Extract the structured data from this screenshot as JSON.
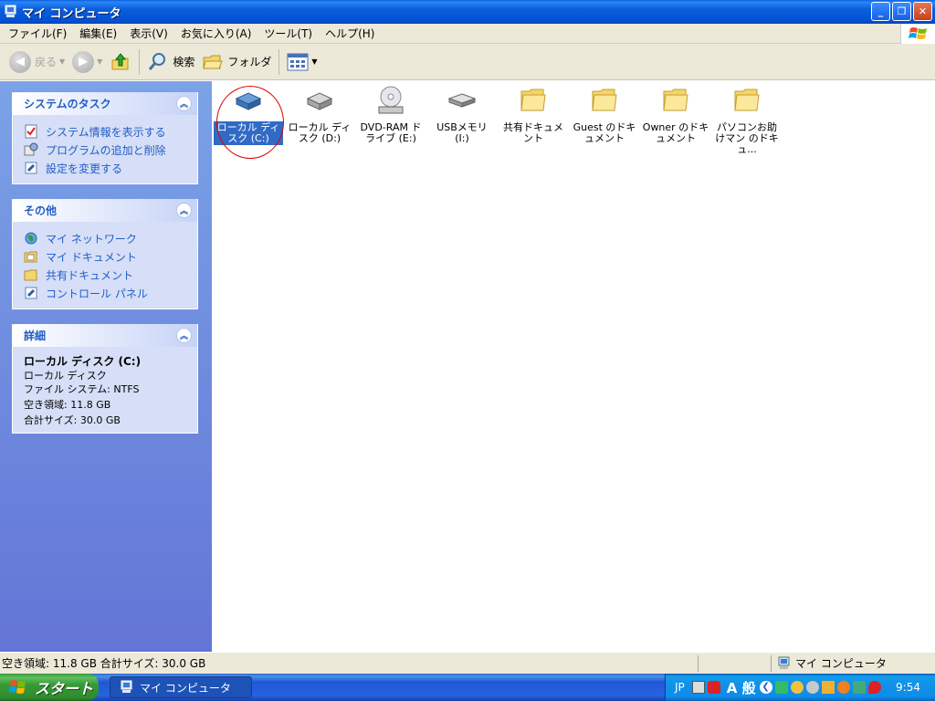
{
  "window": {
    "title": "マイ コンピュータ"
  },
  "menu": [
    "ファイル(F)",
    "編集(E)",
    "表示(V)",
    "お気に入り(A)",
    "ツール(T)",
    "ヘルプ(H)"
  ],
  "toolbar": {
    "back": "戻る",
    "search": "検索",
    "folders": "フォルダ"
  },
  "panels": {
    "tasks": {
      "title": "システムのタスク",
      "items": [
        "システム情報を表示する",
        "プログラムの追加と削除",
        "設定を変更する"
      ]
    },
    "other": {
      "title": "その他",
      "items": [
        "マイ ネットワーク",
        "マイ ドキュメント",
        "共有ドキュメント",
        "コントロール パネル"
      ]
    },
    "details": {
      "title": "詳細",
      "name": "ローカル ディスク (C:)",
      "type": "ローカル ディスク",
      "fs": "ファイル システム: NTFS",
      "free": "空き領域: 11.8 GB",
      "total": "合計サイズ: 30.0 GB"
    }
  },
  "items": [
    {
      "label": "ローカル ディスク (C:)",
      "icon": "hard-drive-c-icon",
      "selected": true
    },
    {
      "label": "ローカル ディスク (D:)",
      "icon": "hard-drive-icon"
    },
    {
      "label": "DVD-RAM ドライブ (E:)",
      "icon": "dvd-drive-icon"
    },
    {
      "label": "USBメモリ (I:)",
      "icon": "usb-drive-icon"
    },
    {
      "label": "共有ドキュメント",
      "icon": "folder-icon"
    },
    {
      "label": "Guest のドキュメント",
      "icon": "folder-icon"
    },
    {
      "label": "Owner のドキュメント",
      "icon": "folder-icon"
    },
    {
      "label": "パソコンお助けマン のドキュ...",
      "icon": "folder-icon"
    }
  ],
  "status": {
    "left": "空き領域: 11.8 GB 合計サイズ: 30.0 GB",
    "right": "マイ コンピュータ"
  },
  "taskbar": {
    "start": "スタート",
    "task": "マイ コンピュータ",
    "lang": "JP",
    "ime": "A 般",
    "clock": "9:54"
  }
}
